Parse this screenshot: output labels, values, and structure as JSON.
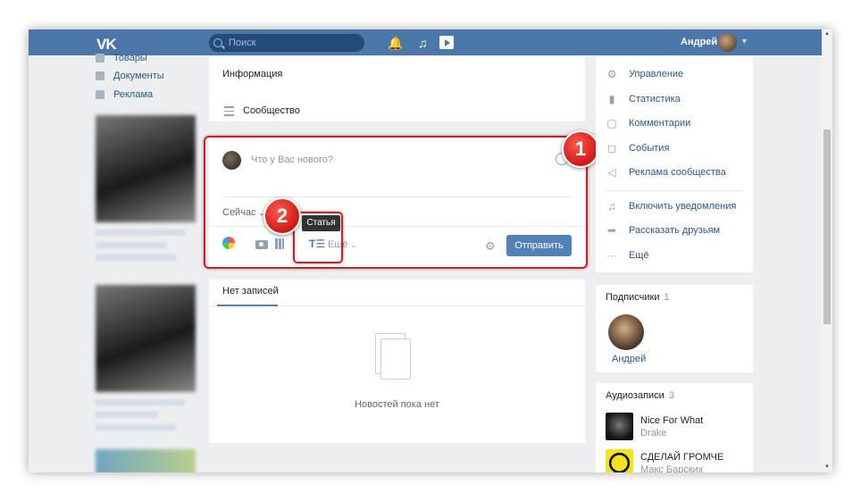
{
  "topbar": {
    "logo": "VK",
    "search_placeholder": "Поиск",
    "user_name": "Андрей"
  },
  "left_nav": [
    {
      "label": "Товары",
      "icon": "bag-icon"
    },
    {
      "label": "Документы",
      "icon": "document-icon"
    },
    {
      "label": "Реклама",
      "icon": "megaphone-icon"
    }
  ],
  "center": {
    "info_title": "Информация",
    "community_label": "Сообщество",
    "post_placeholder": "Что у Вас нового?",
    "when_label": "Сейчас",
    "more_label": "Ещё",
    "send_label": "Отправить",
    "tooltip": "Статья",
    "tab_label": "Нет записей",
    "empty_text": "Новостей пока нет"
  },
  "badges": {
    "first": "1",
    "second": "2"
  },
  "right_menu": [
    {
      "label": "Управление",
      "icon": "gear-icon"
    },
    {
      "label": "Статистика",
      "icon": "chart-icon"
    },
    {
      "label": "Комментарии",
      "icon": "comment-icon"
    },
    {
      "label": "События",
      "icon": "event-icon"
    },
    {
      "label": "Реклама сообщества",
      "icon": "megaphone-icon"
    },
    {
      "label": "Включить уведомления",
      "icon": "bell-icon"
    },
    {
      "label": "Рассказать друзьям",
      "icon": "share-icon"
    },
    {
      "label": "Ещё",
      "icon": "more-icon"
    }
  ],
  "subscribers": {
    "title": "Подписчики",
    "count": "1",
    "name": "Андрей"
  },
  "audio": {
    "title": "Аудиозаписи",
    "count": "3",
    "tracks": [
      {
        "title": "Nice For What",
        "artist": "Drake"
      },
      {
        "title": "СДЕЛАЙ ГРОМЧЕ",
        "artist": "Макс Барских"
      }
    ]
  },
  "colors": {
    "accent": "#4a76a8",
    "button": "#5181b8",
    "highlight": "#d61d1d"
  }
}
